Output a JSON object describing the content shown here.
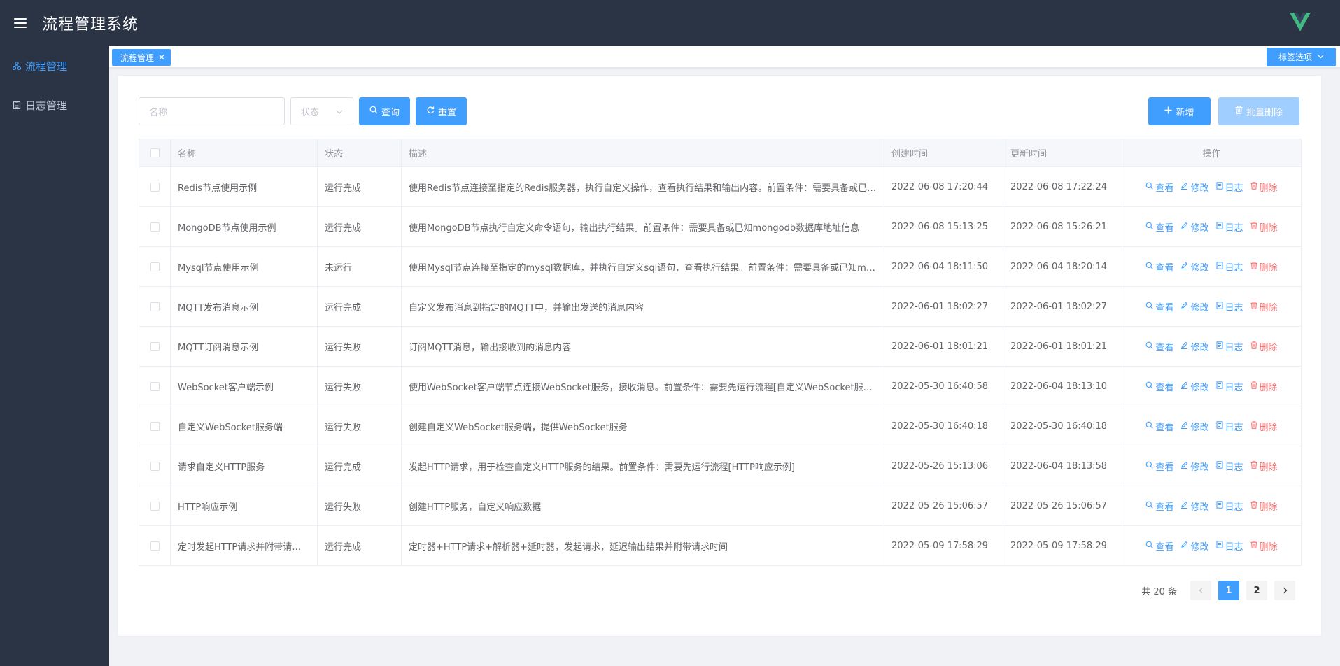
{
  "app": {
    "title": "流程管理系统"
  },
  "sidebar": {
    "items": [
      {
        "label": "流程管理",
        "icon": "flow-icon",
        "active": true
      },
      {
        "label": "日志管理",
        "icon": "clipboard-icon",
        "active": false
      }
    ]
  },
  "tabs": {
    "items": [
      {
        "label": "流程管理",
        "close": "✕"
      }
    ],
    "options_label": "标签选项"
  },
  "search": {
    "name_placeholder": "名称",
    "status_placeholder": "状态",
    "query_label": "查询",
    "reset_label": "重置",
    "add_label": "新增",
    "batch_delete_label": "批量删除"
  },
  "table": {
    "columns": [
      "名称",
      "状态",
      "描述",
      "创建时间",
      "更新时间",
      "操作"
    ],
    "actions": {
      "view": "查看",
      "edit": "修改",
      "log": "日志",
      "delete": "删除"
    },
    "rows": [
      {
        "name": "Redis节点使用示例",
        "status": "运行完成",
        "desc": "使用Redis节点连接至指定的Redis服务器，执行自定义操作，查看执行结果和输出内容。前置条件：需要具备或已知Redis服务器地址",
        "created": "2022-06-08 17:20:44",
        "updated": "2022-06-08 17:22:24"
      },
      {
        "name": "MongoDB节点使用示例",
        "status": "运行完成",
        "desc": "使用MongoDB节点执行自定义命令语句，输出执行结果。前置条件：需要具备或已知mongodb数据库地址信息",
        "created": "2022-06-08 15:13:25",
        "updated": "2022-06-08 15:26:21"
      },
      {
        "name": "Mysql节点使用示例",
        "status": "未运行",
        "desc": "使用Mysql节点连接至指定的mysql数据库，并执行自定义sql语句，查看执行结果。前置条件：需要具备或已知mysql数据库",
        "created": "2022-06-04 18:11:50",
        "updated": "2022-06-04 18:20:14"
      },
      {
        "name": "MQTT发布消息示例",
        "status": "运行完成",
        "desc": "自定义发布消息到指定的MQTT中，并输出发送的消息内容",
        "created": "2022-06-01 18:02:27",
        "updated": "2022-06-01 18:02:27"
      },
      {
        "name": "MQTT订阅消息示例",
        "status": "运行失败",
        "desc": "订阅MQTT消息，输出接收到的消息内容",
        "created": "2022-06-01 18:01:21",
        "updated": "2022-06-01 18:01:21"
      },
      {
        "name": "WebSocket客户端示例",
        "status": "运行失败",
        "desc": "使用WebSocket客户端节点连接WebSocket服务，接收消息。前置条件：需要先运行流程[自定义WebSocket服务端]",
        "created": "2022-05-30 16:40:58",
        "updated": "2022-06-04 18:13:10"
      },
      {
        "name": "自定义WebSocket服务端",
        "status": "运行失败",
        "desc": "创建自定义WebSocket服务端，提供WebSocket服务",
        "created": "2022-05-30 16:40:18",
        "updated": "2022-05-30 16:40:18"
      },
      {
        "name": "请求自定义HTTP服务",
        "status": "运行完成",
        "desc": "发起HTTP请求，用于检查自定义HTTP服务的结果。前置条件：需要先运行流程[HTTP响应示例]",
        "created": "2022-05-26 15:13:06",
        "updated": "2022-06-04 18:13:58"
      },
      {
        "name": "HTTP响应示例",
        "status": "运行失败",
        "desc": "创建HTTP服务，自定义响应数据",
        "created": "2022-05-26 15:06:57",
        "updated": "2022-05-26 15:06:57"
      },
      {
        "name": "定时发起HTTP请求并附带请求时间",
        "status": "运行完成",
        "desc": "定时器+HTTP请求+解析器+延时器，发起请求，延迟输出结果并附带请求时间",
        "created": "2022-05-09 17:58:29",
        "updated": "2022-05-09 17:58:29"
      }
    ]
  },
  "pagination": {
    "total_label": "共 20 条",
    "pages": [
      "1",
      "2"
    ],
    "current": "1"
  },
  "colors": {
    "header_bg": "#2b3445",
    "primary": "#409eff",
    "danger": "#f56c6c",
    "vue_green": "#42b883"
  }
}
